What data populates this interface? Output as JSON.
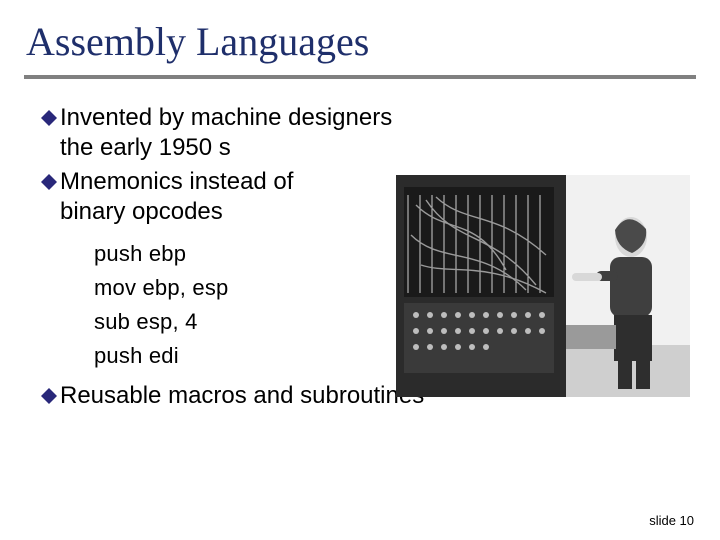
{
  "title": "Assembly Languages",
  "bullets": {
    "b0": "Invented by machine designers the early 1950 s",
    "b1": "Mnemonics instead of binary opcodes",
    "b2": "Reusable macros and subroutines"
  },
  "code": {
    "l0": "push ebp",
    "l1": "mov ebp, esp",
    "l2": "sub esp, 4",
    "l3": "push edi"
  },
  "footer": "slide 10",
  "colors": {
    "title": "#1f2f6b",
    "rule": "#808080",
    "bullet_marker": "#29287a"
  },
  "image_alt": "Black-and-white photo: a woman operating an early computer console with many patch cables and switches"
}
